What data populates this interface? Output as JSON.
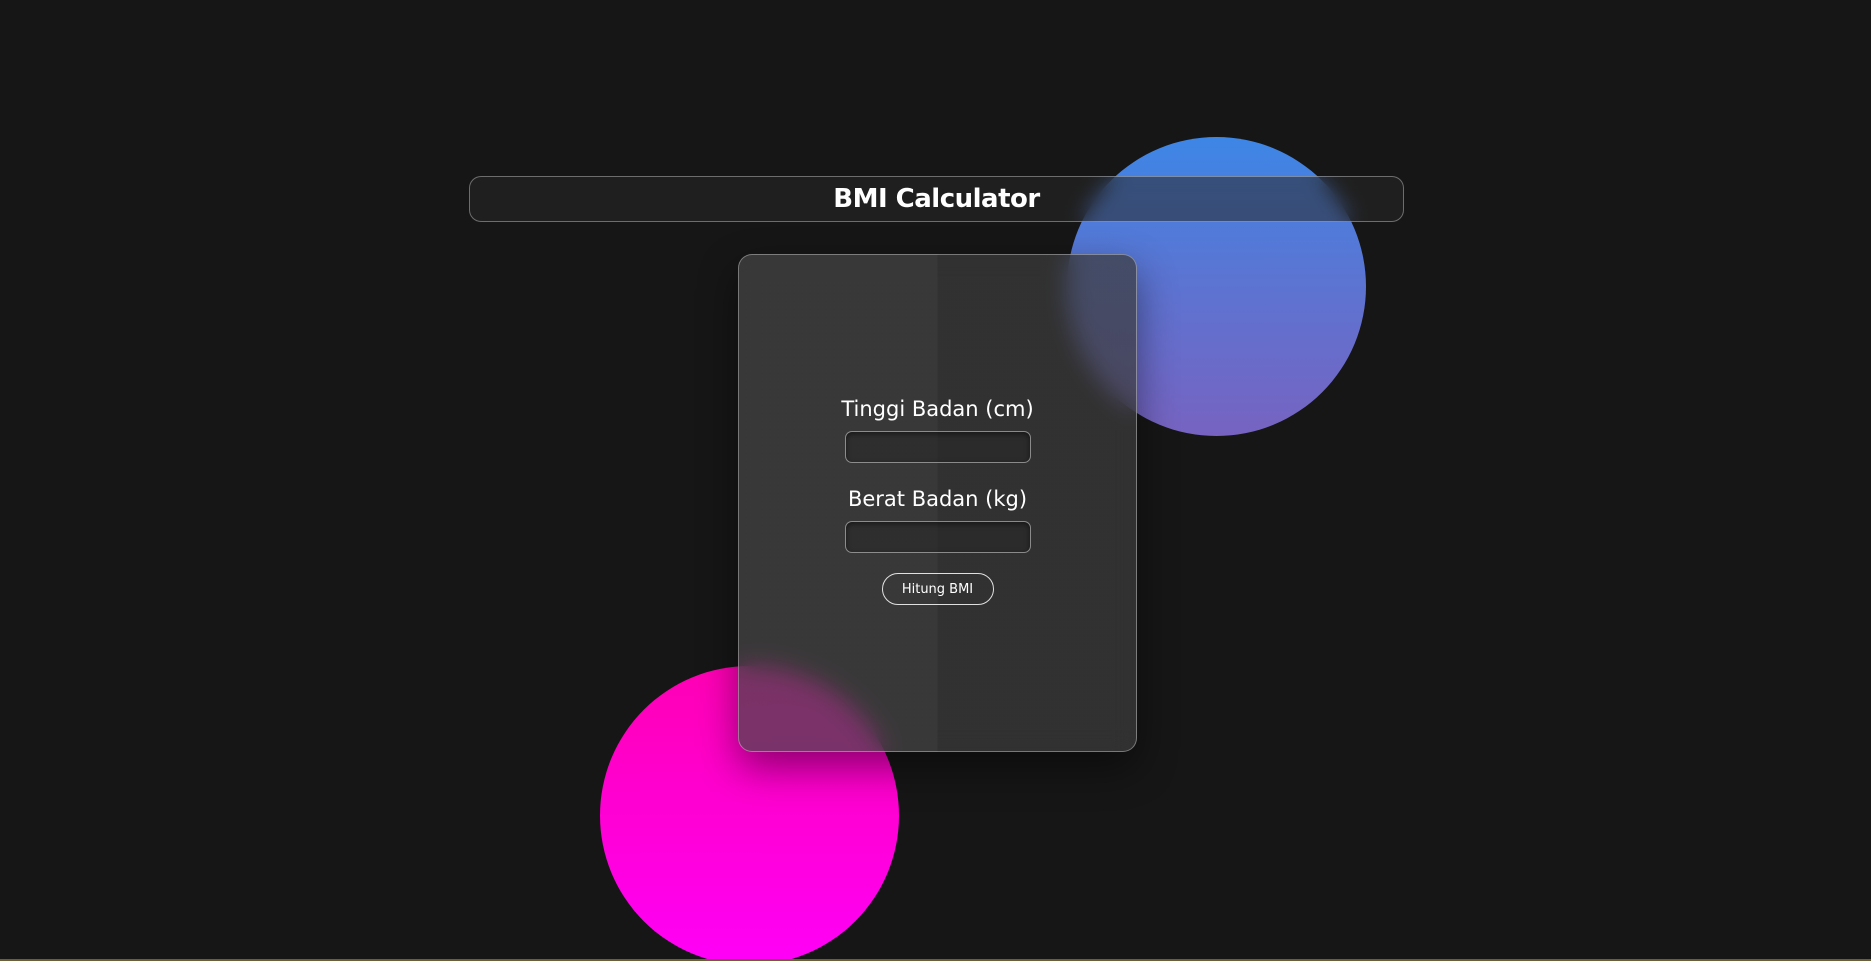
{
  "header": {
    "title": "BMI Calculator"
  },
  "form": {
    "height_label": "Tinggi Badan (cm)",
    "height_value": "",
    "weight_label": "Berat Badan (kg)",
    "weight_value": "",
    "submit_label": "Hitung BMI"
  },
  "colors": {
    "background": "#161616",
    "blob_blue_top": "#3d86e6",
    "blob_blue_bottom": "#7763c1",
    "blob_pink_top": "#ff00b4",
    "blob_pink_bottom": "#ff00f8",
    "text": "#ffffff"
  }
}
